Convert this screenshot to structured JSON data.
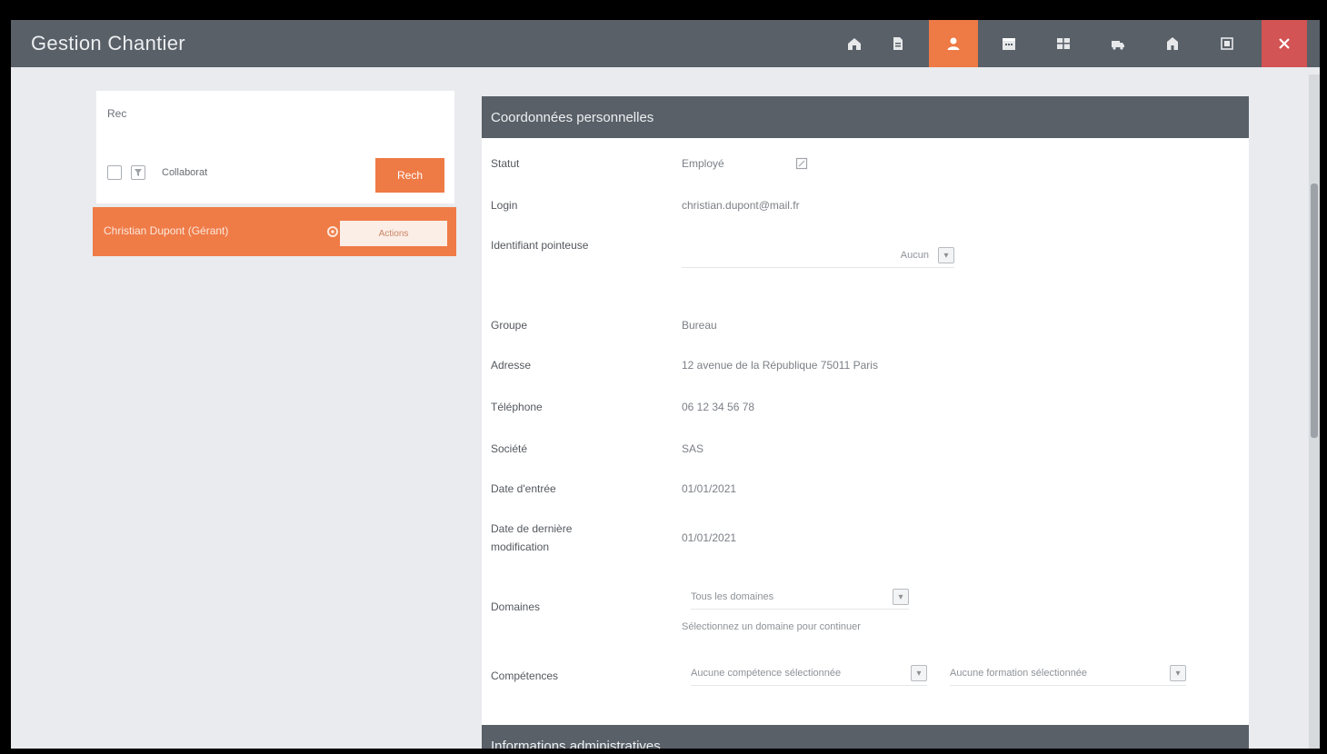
{
  "app": {
    "title": "Gestion Chantier"
  },
  "toolbar": {
    "buttons": [
      {
        "icon": "home-icon"
      },
      {
        "icon": "document-icon"
      },
      {
        "icon": "user-icon",
        "active": true
      },
      {
        "icon": "calendar-icon"
      },
      {
        "icon": "grid-icon"
      },
      {
        "icon": "truck-icon"
      },
      {
        "icon": "building-icon"
      },
      {
        "icon": "settings-icon"
      },
      {
        "icon": "close-icon"
      }
    ],
    "active_color": "#ee7a45",
    "close_color": "#d35454"
  },
  "sidebar": {
    "caption": "Rec",
    "filter_text": "Collaborat",
    "search_button": "Rech",
    "selected": {
      "label": "Christian Dupont (Gérant)",
      "action": "Actions"
    }
  },
  "section1": {
    "title": "Coordonnées personnelles",
    "fields": [
      {
        "label": "Statut",
        "value": "Employé"
      },
      {
        "label": "Login",
        "value": "christian.dupont@mail.fr"
      },
      {
        "label": "Identifiant pointeuse",
        "value": "",
        "dropdown": "Aucun"
      },
      {
        "label": "Groupe",
        "value": "Bureau"
      },
      {
        "label": "Adresse",
        "value": "12 avenue de la République 75011 Paris"
      },
      {
        "label": "Téléphone",
        "value": "06 12 34 56 78"
      },
      {
        "label": "Société",
        "value": "SAS"
      },
      {
        "label": "Date d'entrée",
        "value": "01/01/2021"
      },
      {
        "label": "Date de dernière modification",
        "value": "01/01/2021"
      },
      {
        "label": "Domaines",
        "dropdown": "Tous les domaines",
        "hint": "Sélectionnez un domaine pour continuer"
      },
      {
        "label": "Compétences",
        "dropdown": "Aucune compétence sélectionnée",
        "dropdown2": "Aucune formation sélectionnée"
      }
    ]
  },
  "section2": {
    "title": "Informations administratives"
  }
}
